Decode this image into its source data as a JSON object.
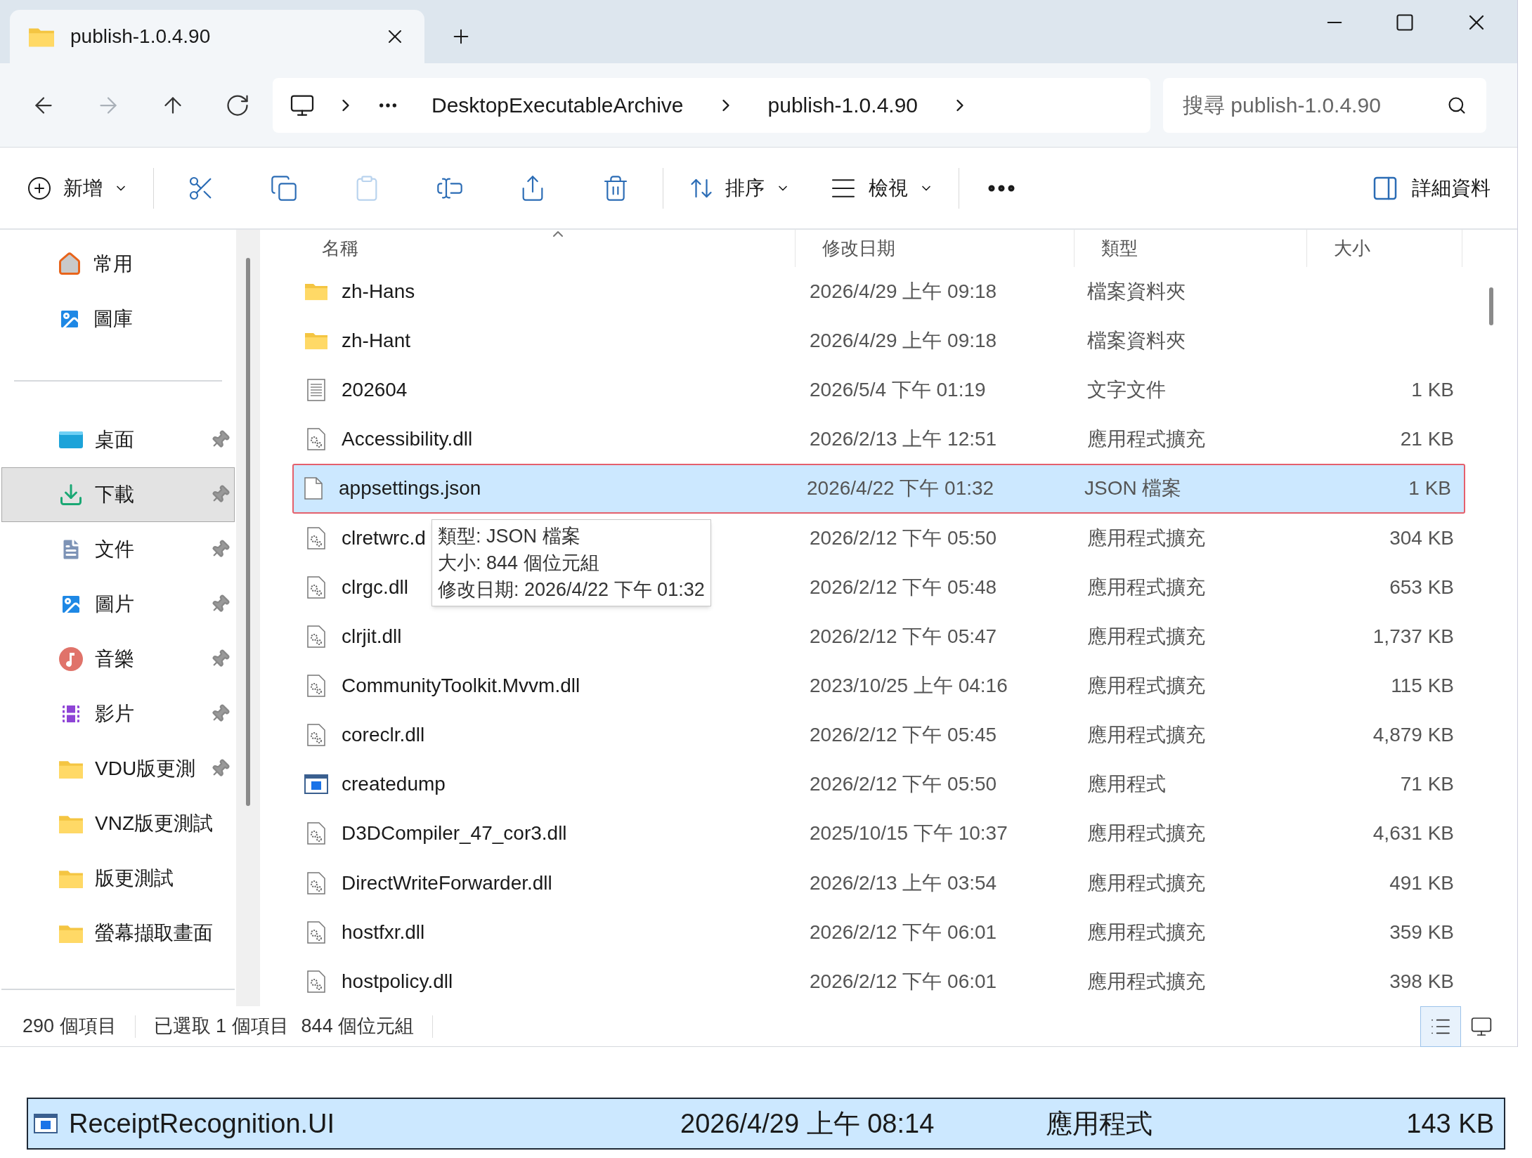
{
  "tab": {
    "title": "publish-1.0.4.90"
  },
  "nav": [
    {
      "kind": "back",
      "disabled": false
    },
    {
      "kind": "forward",
      "disabled": true
    },
    {
      "kind": "up",
      "disabled": false
    },
    {
      "kind": "refresh",
      "disabled": false
    }
  ],
  "address": {
    "segments": [
      "DesktopExecutableArchive",
      "publish-1.0.4.90"
    ]
  },
  "search": {
    "placeholder": "搜尋 publish-1.0.4.90"
  },
  "toolbar": {
    "new": {
      "label": "新增"
    },
    "actions": [
      {
        "kind": "cut",
        "disabled": false
      },
      {
        "kind": "copy",
        "disabled": false
      },
      {
        "kind": "paste",
        "disabled": true
      },
      {
        "kind": "rename",
        "disabled": false
      },
      {
        "kind": "share",
        "disabled": false
      },
      {
        "kind": "delete",
        "disabled": false
      }
    ],
    "sort": {
      "label": "排序"
    },
    "view": {
      "label": "檢視"
    },
    "details": {
      "label": "詳細資料"
    }
  },
  "sidebar": {
    "groups": [
      [
        {
          "label": "常用",
          "kind": "home",
          "pinned": false,
          "selected": false
        },
        {
          "label": "圖庫",
          "kind": "gallery",
          "pinned": false,
          "selected": false
        }
      ],
      [
        {
          "label": "桌面",
          "kind": "desktop",
          "pinned": true,
          "selected": false
        },
        {
          "label": "下載",
          "kind": "download",
          "pinned": true,
          "selected": true
        },
        {
          "label": "文件",
          "kind": "documents",
          "pinned": true,
          "selected": false
        },
        {
          "label": "圖片",
          "kind": "pictures",
          "pinned": true,
          "selected": false
        },
        {
          "label": "音樂",
          "kind": "music",
          "pinned": true,
          "selected": false
        },
        {
          "label": "影片",
          "kind": "videos",
          "pinned": true,
          "selected": false
        },
        {
          "label": "VDU版更測",
          "kind": "folder",
          "pinned": true,
          "selected": false
        },
        {
          "label": "VNZ版更測試",
          "kind": "folder",
          "pinned": false,
          "selected": false
        },
        {
          "label": "版更測試",
          "kind": "folder",
          "pinned": false,
          "selected": false
        },
        {
          "label": "螢幕擷取畫面",
          "kind": "folder",
          "pinned": false,
          "selected": false
        }
      ]
    ]
  },
  "columns": [
    "名稱",
    "修改日期",
    "類型",
    "大小"
  ],
  "rows": [
    {
      "name": "zh-Hans",
      "modified": "2026/4/29 上午 09:18",
      "type": "檔案資料夾",
      "kind": "folder",
      "selected": false
    },
    {
      "name": "zh-Hant",
      "modified": "2026/4/29 上午 09:18",
      "type": "檔案資料夾",
      "kind": "folder",
      "selected": false
    },
    {
      "name": "202604",
      "modified": "2026/5/4 下午 01:19",
      "type": "文字文件",
      "size": "1 KB",
      "kind": "text",
      "selected": false
    },
    {
      "name": "Accessibility.dll",
      "modified": "2026/2/13 上午 12:51",
      "type": "應用程式擴充",
      "size": "21 KB",
      "kind": "dll",
      "selected": false
    },
    {
      "name": "appsettings.json",
      "modified": "2026/4/22 下午 01:32",
      "type": "JSON 檔案",
      "size": "1 KB",
      "kind": "file",
      "selected": true
    },
    {
      "name": "clretwrc.d",
      "modified": "2026/2/12 下午 05:50",
      "type": "應用程式擴充",
      "size": "304 KB",
      "kind": "dll",
      "selected": false
    },
    {
      "name": "clrgc.dll",
      "modified": "2026/2/12 下午 05:48",
      "type": "應用程式擴充",
      "size": "653 KB",
      "kind": "dll",
      "selected": false
    },
    {
      "name": "clrjit.dll",
      "modified": "2026/2/12 下午 05:47",
      "type": "應用程式擴充",
      "size": "1,737 KB",
      "kind": "dll",
      "selected": false
    },
    {
      "name": "CommunityToolkit.Mvvm.dll",
      "modified": "2023/10/25 上午 04:16",
      "type": "應用程式擴充",
      "size": "115 KB",
      "kind": "dll",
      "selected": false
    },
    {
      "name": "coreclr.dll",
      "modified": "2026/2/12 下午 05:45",
      "type": "應用程式擴充",
      "size": "4,879 KB",
      "kind": "dll",
      "selected": false
    },
    {
      "name": "createdump",
      "modified": "2026/2/12 下午 05:50",
      "type": "應用程式",
      "size": "71 KB",
      "kind": "exe",
      "selected": false
    },
    {
      "name": "D3DCompiler_47_cor3.dll",
      "modified": "2025/10/15 下午 10:37",
      "type": "應用程式擴充",
      "size": "4,631 KB",
      "kind": "dll",
      "selected": false
    },
    {
      "name": "DirectWriteForwarder.dll",
      "modified": "2026/2/13 上午 03:54",
      "type": "應用程式擴充",
      "size": "491 KB",
      "kind": "dll",
      "selected": false
    },
    {
      "name": "hostfxr.dll",
      "modified": "2026/2/12 下午 06:01",
      "type": "應用程式擴充",
      "size": "359 KB",
      "kind": "dll",
      "selected": false
    },
    {
      "name": "hostpolicy.dll",
      "modified": "2026/2/12 下午 06:01",
      "type": "應用程式擴充",
      "size": "398 KB",
      "kind": "dll",
      "selected": false
    }
  ],
  "tooltip": {
    "lines": [
      "類型: JSON 檔案",
      "大小: 844 個位元組",
      "修改日期: 2026/4/22 下午 01:32"
    ]
  },
  "status": {
    "count": "290 個項目",
    "selection": "已選取 1 個項目",
    "size": "844 個位元組"
  },
  "view_buttons": [
    {
      "kind": "details",
      "selected": true
    },
    {
      "kind": "tiles",
      "selected": false
    }
  ],
  "drag_row": {
    "name": "ReceiptRecognition.UI",
    "modified": "2026/4/29 上午 08:14",
    "type": "應用程式",
    "size": "143 KB",
    "kind": "exe"
  }
}
